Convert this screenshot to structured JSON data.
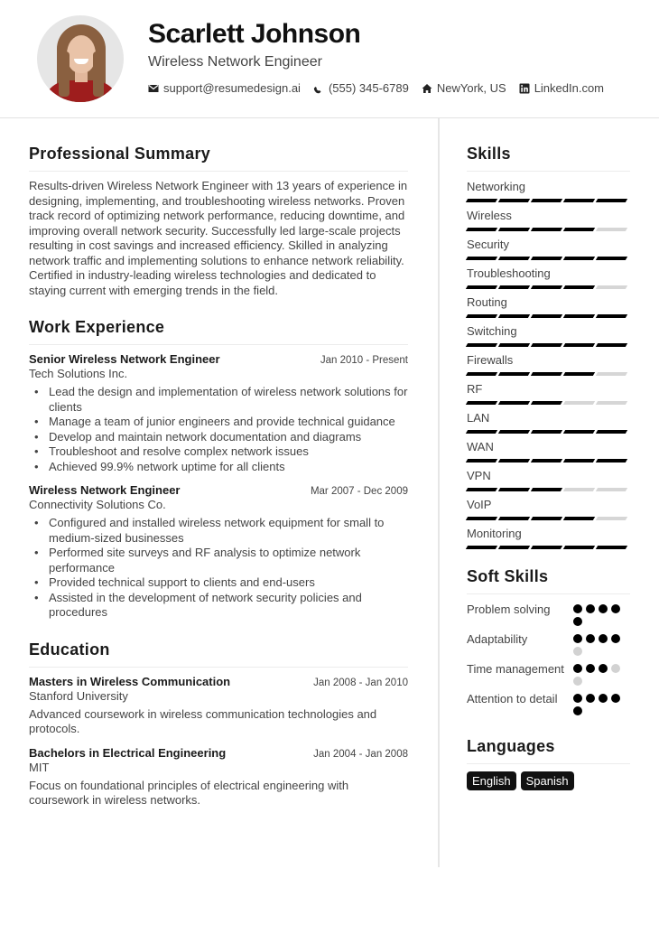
{
  "header": {
    "name": "Scarlett Johnson",
    "title": "Wireless Network Engineer",
    "contacts": [
      {
        "icon": "envelope-icon",
        "text": "support@resumedesign.ai"
      },
      {
        "icon": "phone-icon",
        "text": "(555) 345-6789"
      },
      {
        "icon": "home-icon",
        "text": "NewYork, US"
      },
      {
        "icon": "linkedin-icon",
        "text": "LinkedIn.com"
      }
    ]
  },
  "summary": {
    "heading": "Professional Summary",
    "text": "Results-driven Wireless Network Engineer with 13 years of experience in designing, implementing, and troubleshooting wireless networks. Proven track record of optimizing network performance, reducing downtime, and improving overall network security. Successfully led large-scale projects resulting in cost savings and increased efficiency. Skilled in analyzing network traffic and implementing solutions to enhance network reliability. Certified in industry-leading wireless technologies and dedicated to staying current with emerging trends in the field."
  },
  "experience": {
    "heading": "Work Experience",
    "jobs": [
      {
        "title": "Senior Wireless Network Engineer",
        "date": "Jan 2010 - Present",
        "company": "Tech Solutions Inc.",
        "bullets": [
          "Lead the design and implementation of wireless network solutions for clients",
          "Manage a team of junior engineers and provide technical guidance",
          "Develop and maintain network documentation and diagrams",
          "Troubleshoot and resolve complex network issues",
          "Achieved 99.9% network uptime for all clients"
        ]
      },
      {
        "title": "Wireless Network Engineer",
        "date": "Mar 2007 - Dec 2009",
        "company": "Connectivity Solutions Co.",
        "bullets": [
          "Configured and installed wireless network equipment for small to medium-sized businesses",
          "Performed site surveys and RF analysis to optimize network performance",
          "Provided technical support to clients and end-users",
          "Assisted in the development of network security policies and procedures"
        ]
      }
    ]
  },
  "education": {
    "heading": "Education",
    "items": [
      {
        "degree": "Masters in Wireless Communication",
        "date": "Jan 2008 - Jan 2010",
        "school": "Stanford University",
        "desc": "Advanced coursework in wireless communication technologies and protocols."
      },
      {
        "degree": "Bachelors in Electrical Engineering",
        "date": "Jan 2004 - Jan 2008",
        "school": "MIT",
        "desc": "Focus on foundational principles of electrical engineering with coursework in wireless networks."
      }
    ]
  },
  "skills": {
    "heading": "Skills",
    "max_level": 5,
    "items": [
      {
        "name": "Networking",
        "level": 5
      },
      {
        "name": "Wireless",
        "level": 4
      },
      {
        "name": "Security",
        "level": 5
      },
      {
        "name": "Troubleshooting",
        "level": 4
      },
      {
        "name": "Routing",
        "level": 5
      },
      {
        "name": "Switching",
        "level": 5
      },
      {
        "name": "Firewalls",
        "level": 4
      },
      {
        "name": "RF",
        "level": 3
      },
      {
        "name": "LAN",
        "level": 5
      },
      {
        "name": "WAN",
        "level": 5
      },
      {
        "name": "VPN",
        "level": 3
      },
      {
        "name": "VoIP",
        "level": 4
      },
      {
        "name": "Monitoring",
        "level": 5
      }
    ]
  },
  "soft_skills": {
    "heading": "Soft Skills",
    "max_level": 5,
    "items": [
      {
        "name": "Problem solving",
        "level": 5
      },
      {
        "name": "Adaptability",
        "level": 4
      },
      {
        "name": "Time management",
        "level": 3
      },
      {
        "name": "Attention to detail",
        "level": 5
      }
    ]
  },
  "languages": {
    "heading": "Languages",
    "items": [
      "English",
      "Spanish"
    ]
  },
  "colors": {
    "accent": "#000000",
    "inactive": "#d6d6d6",
    "text": "#444444"
  }
}
